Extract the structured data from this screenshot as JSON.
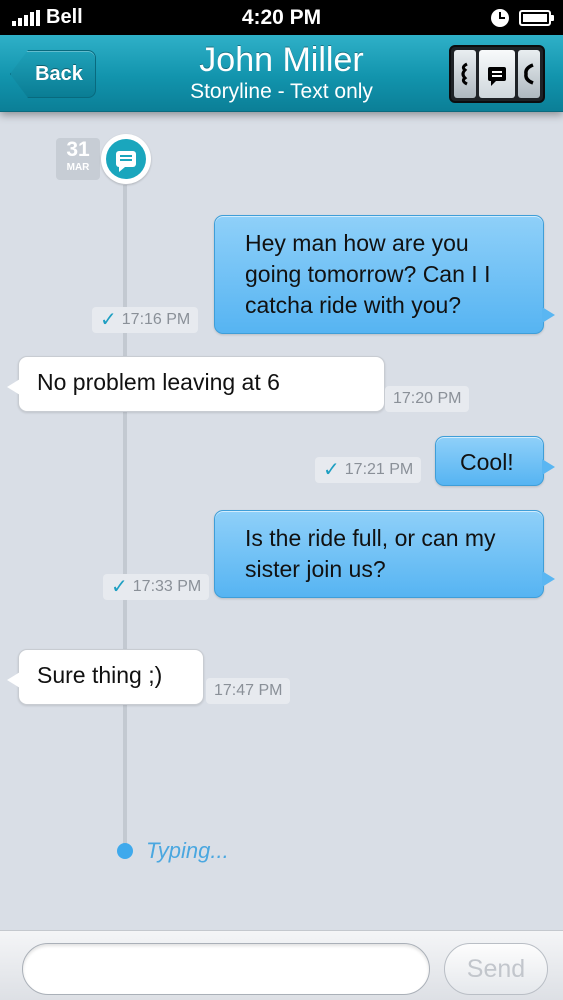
{
  "status_bar": {
    "carrier": "Bell",
    "time": "4:20 PM"
  },
  "nav": {
    "back_label": "Back",
    "contact_name": "John Miller",
    "subtitle": "Storyline - Text only",
    "mode_switch_icons": [
      "left-mode-icon",
      "message-icon",
      "phone-icon"
    ]
  },
  "timeline": {
    "date_day": "31",
    "date_month": "MAR"
  },
  "messages": [
    {
      "direction": "outgoing",
      "text": "Hey man how are you going tomorrow? Can I I catcha ride with you?",
      "time": "17:16 PM"
    },
    {
      "direction": "incoming",
      "text": "No problem leaving at 6",
      "time": "17:20 PM"
    },
    {
      "direction": "outgoing",
      "text": "Cool!",
      "time": "17:21 PM"
    },
    {
      "direction": "outgoing",
      "text": "Is the ride full, or can my sister join us?",
      "time": "17:33 PM"
    },
    {
      "direction": "incoming",
      "text": "Sure thing ;)",
      "time": "17:47 PM"
    }
  ],
  "typing_label": "Typing...",
  "composer": {
    "input_value": "",
    "send_label": "Send"
  },
  "colors": {
    "nav_bar": "#1294ad",
    "outgoing_bubble": "#6cc0f5",
    "incoming_bubble": "#ffffff",
    "background": "#d9dee6",
    "accent": "#1aa6bd"
  }
}
